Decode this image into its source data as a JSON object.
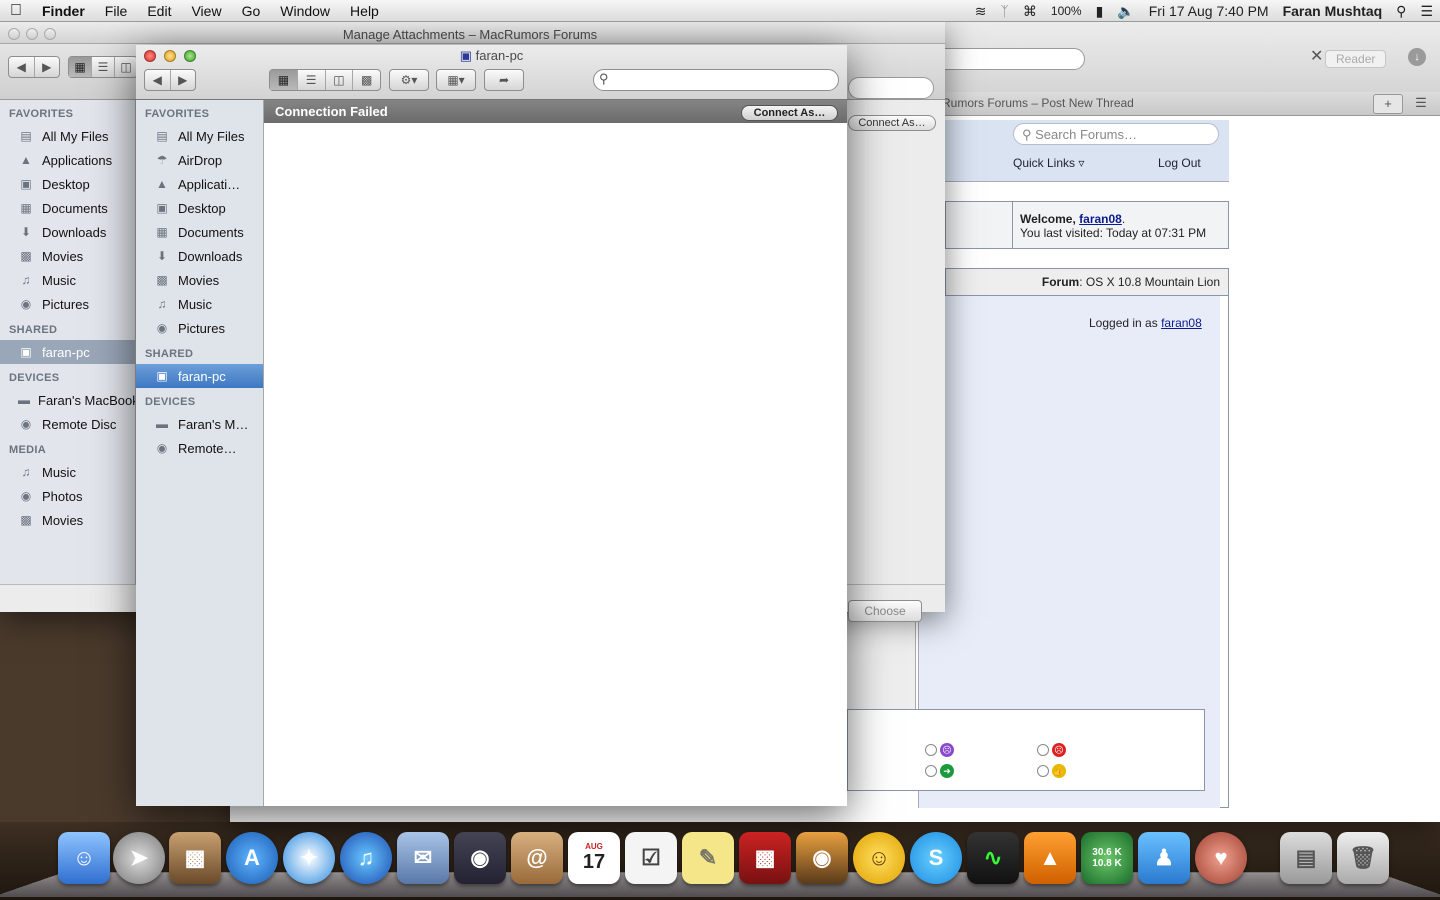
{
  "menubar": {
    "apple": "",
    "app": "Finder",
    "items": [
      "File",
      "Edit",
      "View",
      "Go",
      "Window",
      "Help"
    ],
    "battery": "100%",
    "datetime": "Fri 17 Aug  7:40 PM",
    "user": "Faran Mushtaq"
  },
  "safari": {
    "title_suffix": "s – Post New Thread",
    "reader": "Reader",
    "tab_title": "Rumors Forums – Post New Thread",
    "search_placeholder": "Search Forums…",
    "quick_links": "Quick Links",
    "log_out": "Log Out",
    "welcome_label": "Welcome,",
    "username": "faran08",
    "last_visited": "You last visited: Today at 07:31 PM",
    "forum_label": "Forum",
    "forum_name": ": OS X 10.8 Mountain Lion",
    "logged_in_as": "Logged in as",
    "logged_in_user": "faran08"
  },
  "attach_window": {
    "title": "Manage Attachments – MacRumors Forums",
    "connect_as": "Connect As…",
    "choose": "Choose",
    "sidebar": {
      "favorites_header": "FAVORITES",
      "favorites": [
        "All My Files",
        "Applications",
        "Desktop",
        "Documents",
        "Downloads",
        "Movies",
        "Music",
        "Pictures"
      ],
      "shared_header": "SHARED",
      "shared": [
        "faran-pc"
      ],
      "devices_header": "DEVICES",
      "devices": [
        "Faran's MacBook",
        "Remote Disc"
      ],
      "media_header": "MEDIA",
      "media": [
        "Music",
        "Photos",
        "Movies"
      ]
    }
  },
  "finder": {
    "title": "faran-pc",
    "status": "Connection Failed",
    "connect_as": "Connect As…",
    "sidebar": {
      "favorites_header": "FAVORITES",
      "favorites": [
        "All My Files",
        "AirDrop",
        "Applicati…",
        "Desktop",
        "Documents",
        "Downloads",
        "Movies",
        "Music",
        "Pictures"
      ],
      "shared_header": "SHARED",
      "shared": [
        "faran-pc"
      ],
      "devices_header": "DEVICES",
      "devices": [
        "Faran's M…",
        "Remote…"
      ]
    }
  },
  "dock": {
    "calendar_month": "AUG",
    "calendar_day": "17",
    "net_up": "30.6 K",
    "net_down": "10.8 K"
  }
}
